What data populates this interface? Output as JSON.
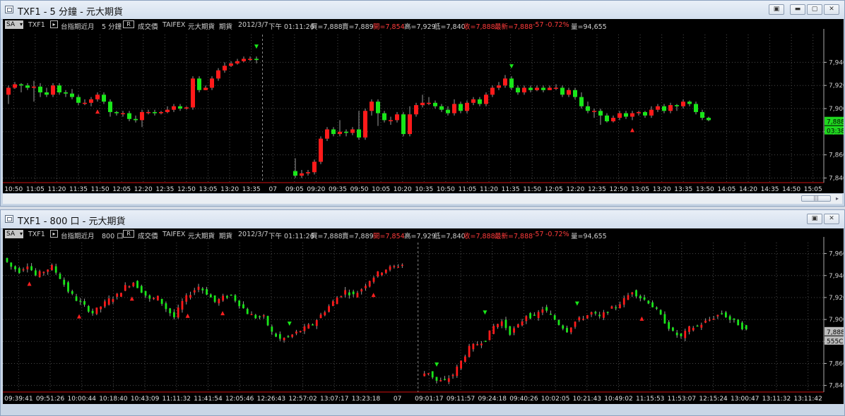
{
  "windows": [
    {
      "title": "TXF1 - 5 分鐘 - 元大期貨",
      "info": {
        "symbol_mode": "SA",
        "symbol": "TXF1",
        "contract": "台指期近月",
        "period": "5 分鐘",
        "r_flag": "R",
        "price_type": "成交價",
        "exchange": "TAIFEX",
        "broker": "元大期貨",
        "kind": "期貨",
        "date": "2012/3/7",
        "time": "下午 01:11:26",
        "buy": "買=7,888",
        "sell": "賣=7,889",
        "open": "開=7,854",
        "high": "高=7,929",
        "low": "低=7,840",
        "close": "收=7,888",
        "latest": "最新=7,888",
        "change": "-57",
        "change_pct": "-0.72%",
        "volume": "量=94,655"
      },
      "price_badges": [
        "7,888",
        "03:38"
      ],
      "chart_data": {
        "type": "candlestick",
        "y_ticks": [
          "7,940",
          "7,920",
          "7,900",
          "7,880",
          "7,860",
          "7,840"
        ],
        "ylim": [
          7836,
          7964
        ],
        "x_ticks": [
          "10:50",
          "11:05",
          "11:20",
          "11:35",
          "11:50",
          "12:05",
          "12:20",
          "12:35",
          "12:50",
          "13:05",
          "13:20",
          "13:35",
          "07",
          "09:05",
          "09:20",
          "09:35",
          "09:50",
          "10:05",
          "10:20",
          "10:35",
          "10:50",
          "11:05",
          "11:20",
          "11:35",
          "11:50",
          "12:05",
          "12:20",
          "12:35",
          "12:50",
          "13:05",
          "13:20",
          "13:35",
          "13:50",
          "14:05",
          "14:20",
          "14:35",
          "14:50",
          "15:05"
        ],
        "candles": [
          [
            7912,
            7918,
            7904,
            7920
          ],
          [
            7918,
            7921,
            7917,
            7923
          ],
          [
            7921,
            7920,
            7914,
            7922
          ],
          [
            7920,
            7918,
            7916,
            7922
          ],
          [
            7918,
            7919,
            7906,
            7924
          ],
          [
            7919,
            7914,
            7910,
            7922
          ],
          [
            7914,
            7912,
            7910,
            7918
          ],
          [
            7912,
            7920,
            7910,
            7922
          ],
          [
            7920,
            7914,
            7912,
            7922
          ],
          [
            7914,
            7913,
            7910,
            7916
          ],
          [
            7913,
            7910,
            7908,
            7917
          ],
          [
            7910,
            7905,
            7903,
            7912
          ],
          [
            7905,
            7905,
            7903,
            7908
          ],
          [
            7905,
            7908,
            7902,
            7910
          ],
          [
            7908,
            7912,
            7906,
            7914
          ],
          [
            7912,
            7906,
            7904,
            7914
          ],
          [
            7906,
            7897,
            7893,
            7908
          ],
          [
            7897,
            7896,
            7894,
            7898
          ],
          [
            7896,
            7896,
            7893,
            7898
          ],
          [
            7896,
            7891,
            7889,
            7898
          ],
          [
            7891,
            7890,
            7888,
            7894
          ],
          [
            7890,
            7897,
            7884,
            7899
          ],
          [
            7897,
            7897,
            7895,
            7899
          ],
          [
            7897,
            7896,
            7894,
            7899
          ],
          [
            7896,
            7897,
            7895,
            7898
          ],
          [
            7897,
            7899,
            7896,
            7902
          ],
          [
            7899,
            7902,
            7897,
            7904
          ],
          [
            7902,
            7900,
            7898,
            7904
          ],
          [
            7900,
            7901,
            7899,
            7902
          ],
          [
            7901,
            7926,
            7899,
            7928
          ],
          [
            7926,
            7916,
            7914,
            7928
          ],
          [
            7916,
            7918,
            7916,
            7920
          ],
          [
            7918,
            7926,
            7916,
            7928
          ],
          [
            7926,
            7933,
            7924,
            7935
          ],
          [
            7933,
            7937,
            7931,
            7940
          ],
          [
            7937,
            7939,
            7936,
            7941
          ],
          [
            7939,
            7941,
            7938,
            7943
          ],
          [
            7941,
            7943,
            7940,
            7945
          ],
          [
            7943,
            7943,
            7941,
            7945
          ],
          [
            7943,
            7942,
            7939,
            7945
          ],
          [
            7846,
            7842,
            7840,
            7857
          ],
          [
            7842,
            7844,
            7840,
            7847
          ],
          [
            7844,
            7845,
            7842,
            7847
          ],
          [
            7845,
            7854,
            7843,
            7856
          ],
          [
            7854,
            7874,
            7852,
            7876
          ],
          [
            7874,
            7882,
            7872,
            7884
          ],
          [
            7882,
            7878,
            7876,
            7884
          ],
          [
            7878,
            7880,
            7876,
            7890
          ],
          [
            7880,
            7879,
            7876,
            7882
          ],
          [
            7879,
            7882,
            7877,
            7884
          ],
          [
            7882,
            7875,
            7873,
            7898
          ],
          [
            7875,
            7898,
            7873,
            7900
          ],
          [
            7898,
            7906,
            7894,
            7908
          ],
          [
            7906,
            7896,
            7885,
            7908
          ],
          [
            7896,
            7890,
            7888,
            7898
          ],
          [
            7890,
            7890,
            7886,
            7893
          ],
          [
            7890,
            7895,
            7888,
            7897
          ],
          [
            7895,
            7878,
            7876,
            7897
          ],
          [
            7878,
            7895,
            7876,
            7902
          ],
          [
            7895,
            7903,
            7893,
            7905
          ],
          [
            7903,
            7905,
            7901,
            7912
          ],
          [
            7905,
            7905,
            7903,
            7910
          ],
          [
            7905,
            7902,
            7900,
            7907
          ],
          [
            7902,
            7899,
            7897,
            7904
          ],
          [
            7899,
            7896,
            7894,
            7902
          ],
          [
            7896,
            7904,
            7894,
            7908
          ],
          [
            7904,
            7898,
            7896,
            7906
          ],
          [
            7898,
            7905,
            7896,
            7907
          ],
          [
            7905,
            7908,
            7903,
            7910
          ],
          [
            7908,
            7904,
            7902,
            7910
          ],
          [
            7904,
            7912,
            7902,
            7914
          ],
          [
            7912,
            7918,
            7910,
            7920
          ],
          [
            7918,
            7920,
            7916,
            7923
          ],
          [
            7920,
            7926,
            7918,
            7929
          ],
          [
            7926,
            7918,
            7916,
            7928
          ],
          [
            7918,
            7914,
            7912,
            7920
          ],
          [
            7914,
            7918,
            7912,
            7920
          ],
          [
            7918,
            7916,
            7914,
            7920
          ],
          [
            7916,
            7918,
            7915,
            7920
          ],
          [
            7918,
            7916,
            7914,
            7920
          ],
          [
            7916,
            7918,
            7916,
            7920
          ],
          [
            7918,
            7918,
            7916,
            7921
          ],
          [
            7918,
            7912,
            7910,
            7920
          ],
          [
            7912,
            7916,
            7910,
            7918
          ],
          [
            7916,
            7910,
            7908,
            7918
          ],
          [
            7910,
            7902,
            7900,
            7914
          ],
          [
            7902,
            7898,
            7896,
            7906
          ],
          [
            7898,
            7898,
            7892,
            7900
          ],
          [
            7898,
            7894,
            7886,
            7900
          ],
          [
            7894,
            7889,
            7888,
            7896
          ],
          [
            7889,
            7892,
            7888,
            7894
          ],
          [
            7892,
            7896,
            7890,
            7898
          ],
          [
            7896,
            7893,
            7891,
            7898
          ],
          [
            7893,
            7896,
            7890,
            7898
          ],
          [
            7896,
            7897,
            7894,
            7898
          ],
          [
            7897,
            7894,
            7892,
            7898
          ],
          [
            7894,
            7899,
            7892,
            7902
          ],
          [
            7899,
            7902,
            7897,
            7904
          ],
          [
            7902,
            7898,
            7896,
            7904
          ],
          [
            7898,
            7903,
            7896,
            7905
          ],
          [
            7903,
            7902,
            7898,
            7904
          ],
          [
            7902,
            7906,
            7900,
            7908
          ],
          [
            7906,
            7904,
            7902,
            7907
          ],
          [
            7904,
            7897,
            7895,
            7906
          ],
          [
            7897,
            7892,
            7890,
            7899
          ],
          [
            7892,
            7890,
            7889,
            7893
          ]
        ],
        "markers": [
          {
            "i": 14,
            "type": "buy"
          },
          {
            "i": 39,
            "type": "sell"
          },
          {
            "i": 74,
            "type": "sell"
          },
          {
            "i": 93,
            "type": "buy"
          }
        ]
      }
    },
    {
      "title": "TXF1 - 800 口 - 元大期貨",
      "info": {
        "symbol_mode": "SA",
        "symbol": "TXF1",
        "contract": "台指期近月",
        "period": "800 口",
        "r_flag": "R",
        "price_type": "成交價",
        "exchange": "TAIFEX",
        "broker": "元大期貨",
        "kind": "期貨",
        "date": "2012/3/7",
        "time": "下午 01:11:26",
        "buy": "買=7,888",
        "sell": "賣=7,889",
        "open": "開=7,854",
        "high": "高=7,929",
        "low": "低=7,840",
        "close": "收=7,888",
        "latest": "最新=7,888",
        "change": "-57",
        "change_pct": "-0.72%",
        "volume": "量=94,655"
      },
      "price_badges": [
        "7,888",
        "555C"
      ],
      "chart_data": {
        "type": "candlestick",
        "y_ticks": [
          "7,960",
          "7,940",
          "7,920",
          "7,900",
          "7,880",
          "7,860",
          "7,840"
        ],
        "ylim": [
          7834,
          7970
        ],
        "x_ticks": [
          "09:39:41",
          "09:51:26",
          "10:00:44",
          "10:18:40",
          "10:43:09",
          "11:11:32",
          "11:41:54",
          "12:05:46",
          "12:26:43",
          "12:57:02",
          "13:07:17",
          "13:23:18",
          "07",
          "09:01:17",
          "09:11:57",
          "09:24:18",
          "09:40:26",
          "10:02:05",
          "10:21:43",
          "10:49:02",
          "11:15:53",
          "11:53:07",
          "12:15:24",
          "13:00:47",
          "13:11:32",
          "13:11:42"
        ],
        "path": [
          7956,
          7948,
          7944,
          7950,
          7940,
          7944,
          7948,
          7938,
          7926,
          7918,
          7912,
          7906,
          7912,
          7918,
          7922,
          7930,
          7934,
          7926,
          7918,
          7920,
          7910,
          7902,
          7916,
          7924,
          7930,
          7924,
          7916,
          7920,
          7922,
          7914,
          7906,
          7902,
          7902,
          7888,
          7882,
          7884,
          7888,
          7892,
          7896,
          7904,
          7912,
          7920,
          7926,
          7922,
          7928,
          7936,
          7942,
          7946,
          7948,
          7950,
          7850,
          7852,
          7844,
          7844,
          7850,
          7862,
          7874,
          7878,
          7882,
          7894,
          7898,
          7888,
          7894,
          7904,
          7902,
          7910,
          7904,
          7896,
          7890,
          7898,
          7902,
          7906,
          7902,
          7908,
          7912,
          7918,
          7926,
          7920,
          7916,
          7908,
          7898,
          7888,
          7884,
          7892,
          7894,
          7898,
          7902,
          7906,
          7900,
          7896,
          7890
        ],
        "markers": [
          {
            "f": 0.03,
            "type": "buy"
          },
          {
            "f": 0.097,
            "type": "buy"
          },
          {
            "f": 0.168,
            "type": "buy"
          },
          {
            "f": 0.243,
            "type": "buy"
          },
          {
            "f": 0.29,
            "type": "buy"
          },
          {
            "f": 0.38,
            "type": "sell"
          },
          {
            "f": 0.493,
            "type": "buy"
          },
          {
            "f": 0.578,
            "type": "sell"
          },
          {
            "f": 0.643,
            "type": "sell"
          },
          {
            "f": 0.767,
            "type": "sell"
          },
          {
            "f": 0.854,
            "type": "buy"
          }
        ]
      }
    }
  ],
  "colors": {
    "up": "#ff1a1a",
    "down": "#19e619",
    "buy_marker": "#ff2020",
    "sell_marker": "#19e619",
    "badge_green": "#1fd81f",
    "badge_grey": "#bdbdbd"
  }
}
